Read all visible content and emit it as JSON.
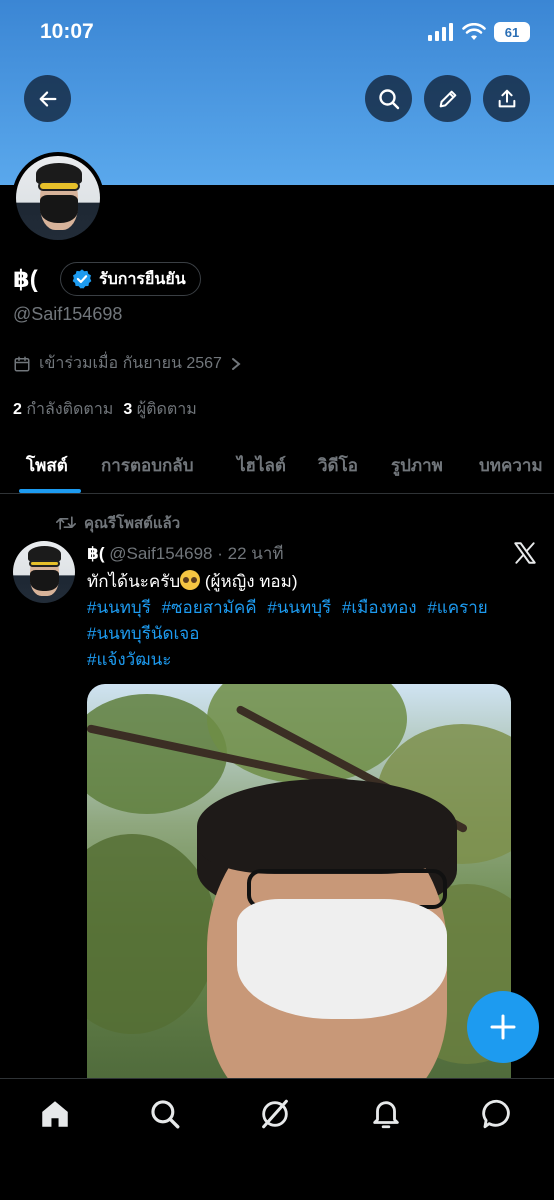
{
  "status_bar": {
    "time": "10:07",
    "battery": "61"
  },
  "header": {
    "back_icon": "arrow-left-icon",
    "search_icon": "search-icon",
    "edit_icon": "pencil-icon",
    "share_icon": "share-icon"
  },
  "profile": {
    "display_name": "฿(",
    "verified_label": "รับการยืนยัน",
    "handle": "@Saif154698",
    "joined": "เข้าร่วมเมื่อ กันยายน 2567",
    "following_count": "2",
    "following_label": "กำลังติดตาม",
    "followers_count": "3",
    "followers_label": "ผู้ติดตาม"
  },
  "tabs": [
    {
      "label": "โพสต์"
    },
    {
      "label": "การตอบกลับ"
    },
    {
      "label": "ไฮไลต์"
    },
    {
      "label": "วิดีโอ"
    },
    {
      "label": "รูปภาพ"
    },
    {
      "label": "บทความ"
    }
  ],
  "post": {
    "repost_label": "คุณรีโพสต์แล้ว",
    "author_name": "฿(",
    "author_handle": "@Saif154698",
    "time": "· 22 นาที",
    "text_before": "ทักได้นะครับ",
    "text_after": "(ผู้หญิง ทอม)",
    "hashtags": [
      "#นนทบุรี",
      "#ซอยสามัคคี",
      "#นนทบุรี",
      "#เมืองทอง",
      "#แคราย",
      "#นนทบุรีนัดเจอ",
      "#แจ้งวัฒนะ"
    ]
  },
  "colors": {
    "accent": "#1d9bf0",
    "banner": "#4a9ae2",
    "background": "#000000",
    "muted": "#71767b"
  },
  "bottom_nav": [
    "home-icon",
    "search-icon",
    "grok-icon",
    "bell-icon",
    "messages-icon"
  ]
}
